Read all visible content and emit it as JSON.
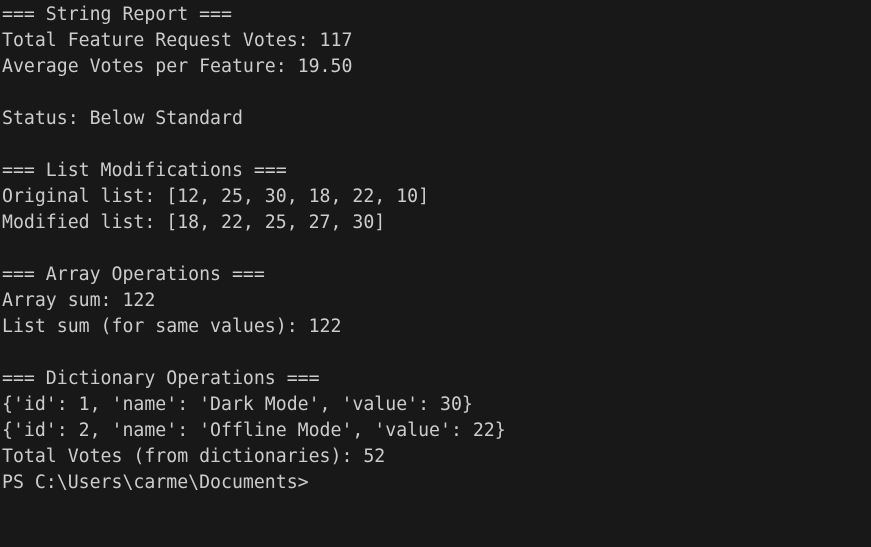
{
  "terminal": {
    "lines": [
      "=== String Report ===",
      "Total Feature Request Votes: 117",
      "Average Votes per Feature: 19.50",
      "",
      "Status: Below Standard",
      "",
      "=== List Modifications ===",
      "Original list: [12, 25, 30, 18, 22, 10]",
      "Modified list: [18, 22, 25, 27, 30]",
      "",
      "=== Array Operations ===",
      "Array sum: 122",
      "List sum (for same values): 122",
      "",
      "=== Dictionary Operations ===",
      "{'id': 1, 'name': 'Dark Mode', 'value': 30}",
      "{'id': 2, 'name': 'Offline Mode', 'value': 22}",
      "Total Votes (from dictionaries): 52"
    ],
    "prompt": "PS C:\\Users\\carme\\Documents>"
  }
}
